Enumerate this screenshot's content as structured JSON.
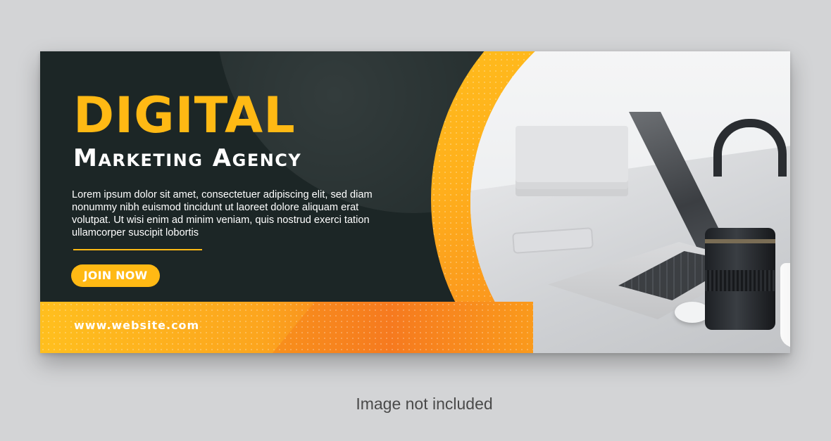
{
  "banner": {
    "title": "DIGITAL",
    "subtitle": "Marketing Agency",
    "body": "Lorem ipsum dolor sit amet, consectetuer adipiscing elit, sed diam nonummy nibh euismod tincidunt ut laoreet dolore aliquam erat volutpat. Ut wisi enim ad minim veniam, quis nostrud exerci tation ullamcorper suscipit lobortis",
    "cta_label": "JOIN NOW",
    "website": "www.website.com"
  },
  "caption": "Image not included",
  "colors": {
    "accent": "#ffb914",
    "background": "#1c2626",
    "orange": "#f6742b",
    "page": "#d3d4d6"
  }
}
